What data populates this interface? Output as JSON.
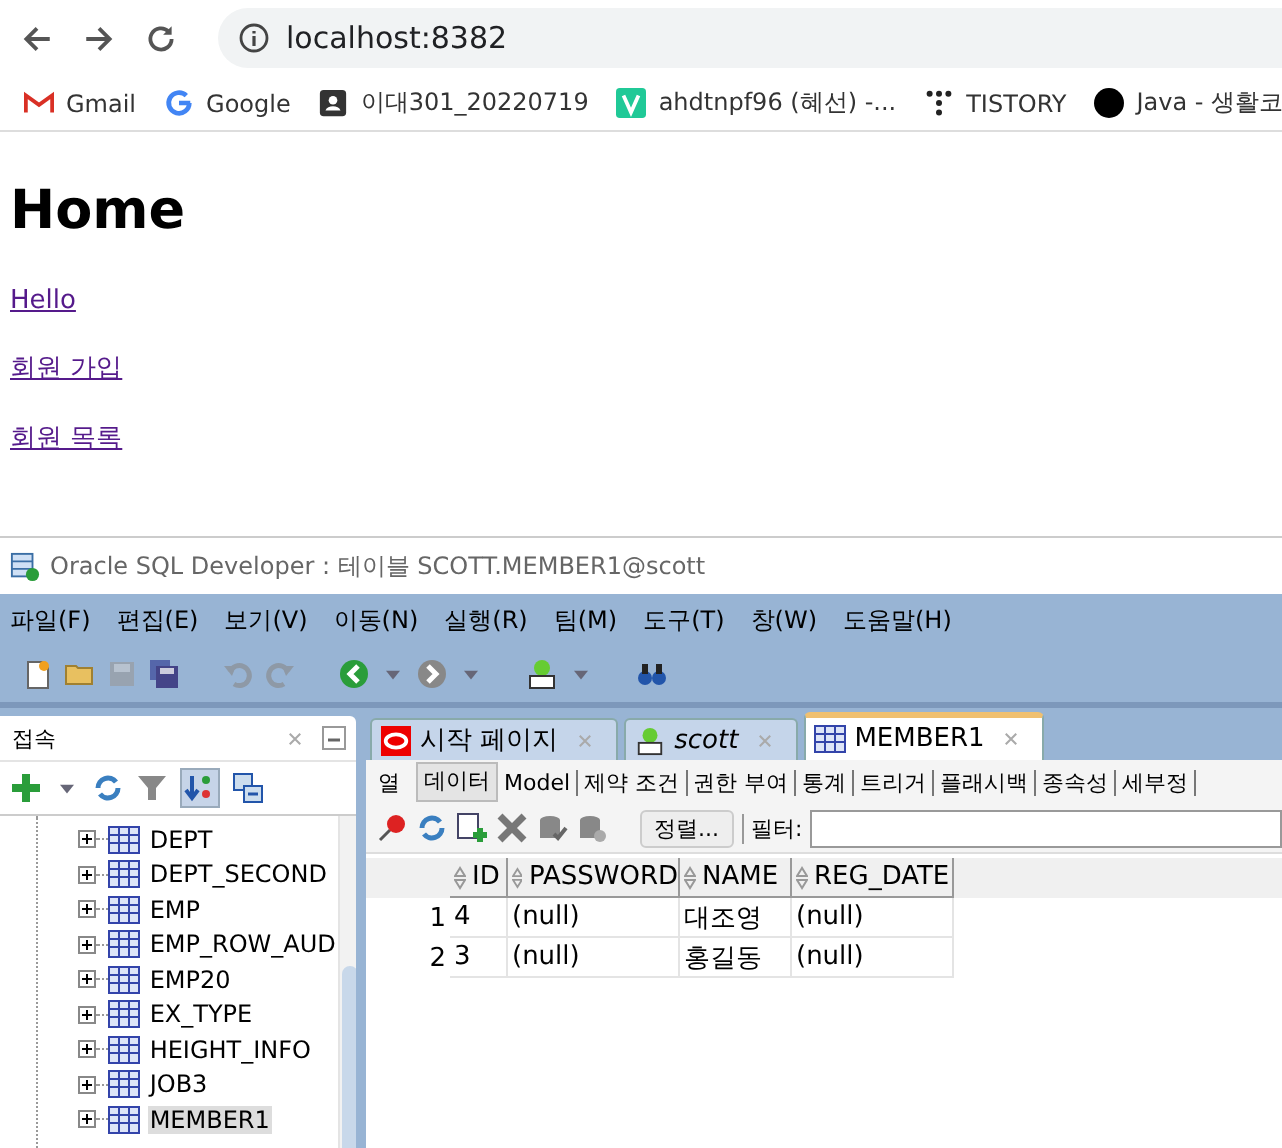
{
  "browser": {
    "address": "localhost:8382",
    "bookmarks": [
      {
        "kind": "gmail",
        "label": "Gmail"
      },
      {
        "kind": "google",
        "label": "Google"
      },
      {
        "kind": "contact",
        "label": "이대301_20220719"
      },
      {
        "kind": "v",
        "label": "ahdtnpf96 (혜선) -..."
      },
      {
        "kind": "tistory",
        "label": "TISTORY"
      },
      {
        "kind": "circle",
        "label": "Java - 생활코"
      }
    ]
  },
  "page": {
    "heading": "Home",
    "links": [
      "Hello",
      "회원 가입",
      "회원 목록"
    ]
  },
  "sqldev": {
    "title": "Oracle SQL Developer : 테이블 SCOTT.MEMBER1@scott",
    "menu": [
      "파일(F)",
      "편집(E)",
      "보기(V)",
      "이동(N)",
      "실행(R)",
      "팀(M)",
      "도구(T)",
      "창(W)",
      "도움말(H)"
    ],
    "connections": {
      "title": "접속",
      "tables": [
        {
          "name": "DEPT",
          "selected": false
        },
        {
          "name": "DEPT_SECOND",
          "selected": false
        },
        {
          "name": "EMP",
          "selected": false
        },
        {
          "name": "EMP_ROW_AUD",
          "selected": false
        },
        {
          "name": "EMP20",
          "selected": false
        },
        {
          "name": "EX_TYPE",
          "selected": false
        },
        {
          "name": "HEIGHT_INFO",
          "selected": false
        },
        {
          "name": "JOB3",
          "selected": false
        },
        {
          "name": "MEMBER1",
          "selected": true
        }
      ]
    },
    "editor_tabs": [
      {
        "kind": "oracle",
        "label": "시작 페이지",
        "selected": false
      },
      {
        "kind": "sql",
        "label": "scott",
        "selected": false
      },
      {
        "kind": "table",
        "label": "MEMBER1",
        "selected": true
      }
    ],
    "subtabs": [
      {
        "label": "열",
        "selected": false
      },
      {
        "label": "데이터",
        "selected": true
      },
      {
        "label": "Model",
        "selected": false
      },
      {
        "label": "제약 조건",
        "selected": false
      },
      {
        "label": "권한 부여",
        "selected": false
      },
      {
        "label": "통계",
        "selected": false
      },
      {
        "label": "트리거",
        "selected": false
      },
      {
        "label": "플래시백",
        "selected": false
      },
      {
        "label": "종속성",
        "selected": false
      },
      {
        "label": "세부정",
        "selected": false
      }
    ],
    "sort_button": "정렬...",
    "filter_label": "필터:",
    "grid": {
      "columns": [
        "ID",
        "PASSWORD",
        "NAME",
        "REG_DATE"
      ],
      "rows": [
        {
          "num": "1",
          "cells": [
            "4",
            "(null)",
            "대조영",
            "(null)"
          ]
        },
        {
          "num": "2",
          "cells": [
            "3",
            "(null)",
            "홍길동",
            "(null)"
          ]
        }
      ]
    }
  }
}
